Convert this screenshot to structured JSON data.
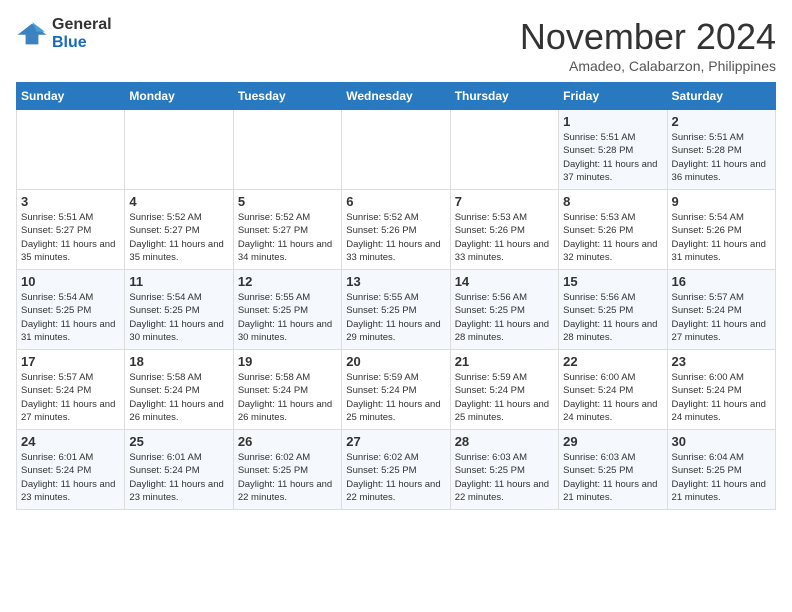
{
  "logo": {
    "line1": "General",
    "line2": "Blue"
  },
  "title": "November 2024",
  "subtitle": "Amadeo, Calabarzon, Philippines",
  "days_of_week": [
    "Sunday",
    "Monday",
    "Tuesday",
    "Wednesday",
    "Thursday",
    "Friday",
    "Saturday"
  ],
  "weeks": [
    [
      {
        "num": "",
        "sunrise": "",
        "sunset": "",
        "daylight": ""
      },
      {
        "num": "",
        "sunrise": "",
        "sunset": "",
        "daylight": ""
      },
      {
        "num": "",
        "sunrise": "",
        "sunset": "",
        "daylight": ""
      },
      {
        "num": "",
        "sunrise": "",
        "sunset": "",
        "daylight": ""
      },
      {
        "num": "",
        "sunrise": "",
        "sunset": "",
        "daylight": ""
      },
      {
        "num": "1",
        "sunrise": "Sunrise: 5:51 AM",
        "sunset": "Sunset: 5:28 PM",
        "daylight": "Daylight: 11 hours and 37 minutes."
      },
      {
        "num": "2",
        "sunrise": "Sunrise: 5:51 AM",
        "sunset": "Sunset: 5:28 PM",
        "daylight": "Daylight: 11 hours and 36 minutes."
      }
    ],
    [
      {
        "num": "3",
        "sunrise": "Sunrise: 5:51 AM",
        "sunset": "Sunset: 5:27 PM",
        "daylight": "Daylight: 11 hours and 35 minutes."
      },
      {
        "num": "4",
        "sunrise": "Sunrise: 5:52 AM",
        "sunset": "Sunset: 5:27 PM",
        "daylight": "Daylight: 11 hours and 35 minutes."
      },
      {
        "num": "5",
        "sunrise": "Sunrise: 5:52 AM",
        "sunset": "Sunset: 5:27 PM",
        "daylight": "Daylight: 11 hours and 34 minutes."
      },
      {
        "num": "6",
        "sunrise": "Sunrise: 5:52 AM",
        "sunset": "Sunset: 5:26 PM",
        "daylight": "Daylight: 11 hours and 33 minutes."
      },
      {
        "num": "7",
        "sunrise": "Sunrise: 5:53 AM",
        "sunset": "Sunset: 5:26 PM",
        "daylight": "Daylight: 11 hours and 33 minutes."
      },
      {
        "num": "8",
        "sunrise": "Sunrise: 5:53 AM",
        "sunset": "Sunset: 5:26 PM",
        "daylight": "Daylight: 11 hours and 32 minutes."
      },
      {
        "num": "9",
        "sunrise": "Sunrise: 5:54 AM",
        "sunset": "Sunset: 5:26 PM",
        "daylight": "Daylight: 11 hours and 31 minutes."
      }
    ],
    [
      {
        "num": "10",
        "sunrise": "Sunrise: 5:54 AM",
        "sunset": "Sunset: 5:25 PM",
        "daylight": "Daylight: 11 hours and 31 minutes."
      },
      {
        "num": "11",
        "sunrise": "Sunrise: 5:54 AM",
        "sunset": "Sunset: 5:25 PM",
        "daylight": "Daylight: 11 hours and 30 minutes."
      },
      {
        "num": "12",
        "sunrise": "Sunrise: 5:55 AM",
        "sunset": "Sunset: 5:25 PM",
        "daylight": "Daylight: 11 hours and 30 minutes."
      },
      {
        "num": "13",
        "sunrise": "Sunrise: 5:55 AM",
        "sunset": "Sunset: 5:25 PM",
        "daylight": "Daylight: 11 hours and 29 minutes."
      },
      {
        "num": "14",
        "sunrise": "Sunrise: 5:56 AM",
        "sunset": "Sunset: 5:25 PM",
        "daylight": "Daylight: 11 hours and 28 minutes."
      },
      {
        "num": "15",
        "sunrise": "Sunrise: 5:56 AM",
        "sunset": "Sunset: 5:25 PM",
        "daylight": "Daylight: 11 hours and 28 minutes."
      },
      {
        "num": "16",
        "sunrise": "Sunrise: 5:57 AM",
        "sunset": "Sunset: 5:24 PM",
        "daylight": "Daylight: 11 hours and 27 minutes."
      }
    ],
    [
      {
        "num": "17",
        "sunrise": "Sunrise: 5:57 AM",
        "sunset": "Sunset: 5:24 PM",
        "daylight": "Daylight: 11 hours and 27 minutes."
      },
      {
        "num": "18",
        "sunrise": "Sunrise: 5:58 AM",
        "sunset": "Sunset: 5:24 PM",
        "daylight": "Daylight: 11 hours and 26 minutes."
      },
      {
        "num": "19",
        "sunrise": "Sunrise: 5:58 AM",
        "sunset": "Sunset: 5:24 PM",
        "daylight": "Daylight: 11 hours and 26 minutes."
      },
      {
        "num": "20",
        "sunrise": "Sunrise: 5:59 AM",
        "sunset": "Sunset: 5:24 PM",
        "daylight": "Daylight: 11 hours and 25 minutes."
      },
      {
        "num": "21",
        "sunrise": "Sunrise: 5:59 AM",
        "sunset": "Sunset: 5:24 PM",
        "daylight": "Daylight: 11 hours and 25 minutes."
      },
      {
        "num": "22",
        "sunrise": "Sunrise: 6:00 AM",
        "sunset": "Sunset: 5:24 PM",
        "daylight": "Daylight: 11 hours and 24 minutes."
      },
      {
        "num": "23",
        "sunrise": "Sunrise: 6:00 AM",
        "sunset": "Sunset: 5:24 PM",
        "daylight": "Daylight: 11 hours and 24 minutes."
      }
    ],
    [
      {
        "num": "24",
        "sunrise": "Sunrise: 6:01 AM",
        "sunset": "Sunset: 5:24 PM",
        "daylight": "Daylight: 11 hours and 23 minutes."
      },
      {
        "num": "25",
        "sunrise": "Sunrise: 6:01 AM",
        "sunset": "Sunset: 5:24 PM",
        "daylight": "Daylight: 11 hours and 23 minutes."
      },
      {
        "num": "26",
        "sunrise": "Sunrise: 6:02 AM",
        "sunset": "Sunset: 5:25 PM",
        "daylight": "Daylight: 11 hours and 22 minutes."
      },
      {
        "num": "27",
        "sunrise": "Sunrise: 6:02 AM",
        "sunset": "Sunset: 5:25 PM",
        "daylight": "Daylight: 11 hours and 22 minutes."
      },
      {
        "num": "28",
        "sunrise": "Sunrise: 6:03 AM",
        "sunset": "Sunset: 5:25 PM",
        "daylight": "Daylight: 11 hours and 22 minutes."
      },
      {
        "num": "29",
        "sunrise": "Sunrise: 6:03 AM",
        "sunset": "Sunset: 5:25 PM",
        "daylight": "Daylight: 11 hours and 21 minutes."
      },
      {
        "num": "30",
        "sunrise": "Sunrise: 6:04 AM",
        "sunset": "Sunset: 5:25 PM",
        "daylight": "Daylight: 11 hours and 21 minutes."
      }
    ]
  ]
}
